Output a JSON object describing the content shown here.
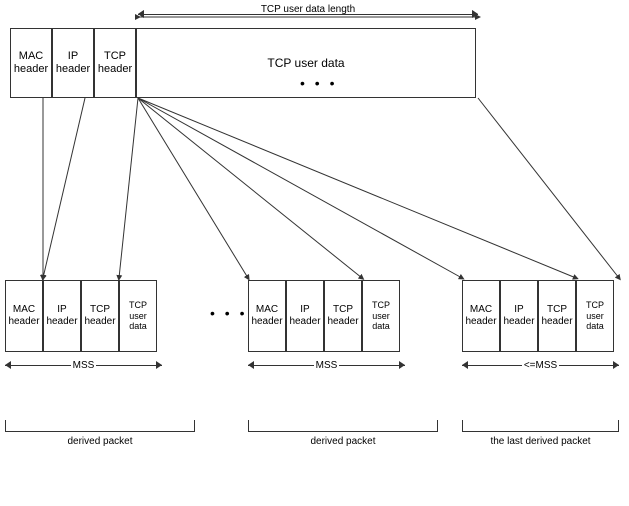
{
  "top_packet": {
    "mac_header": "MAC\nheader",
    "ip_header": "IP\nheader",
    "tcp_header": "TCP\nheader",
    "tcp_data": "TCP user data"
  },
  "tcp_length_label": "TCP user data length",
  "dots_top": "• • •",
  "dots_bottom": "• • •",
  "bottom_packets": [
    {
      "mac": "MAC\nheader",
      "ip": "IP\nheader",
      "tcp": "TCP\nheader",
      "data": "TCP\nuser\ndata",
      "mss_label": "◄ MSS ►",
      "bracket_label": "derived packet"
    },
    {
      "mac": "MAC\nheader",
      "ip": "IP\nheader",
      "tcp": "TCP\nheader",
      "data": "TCP\nuser\ndata",
      "mss_label": "◄ MSS ►",
      "bracket_label": "derived packet"
    },
    {
      "mac": "MAC\nheader",
      "ip": "IP\nheader",
      "tcp": "TCP\nheader",
      "data": "TCP\nuser\ndata",
      "mss_label": "◄=MSS ►",
      "bracket_label": "the last derived packet"
    }
  ]
}
